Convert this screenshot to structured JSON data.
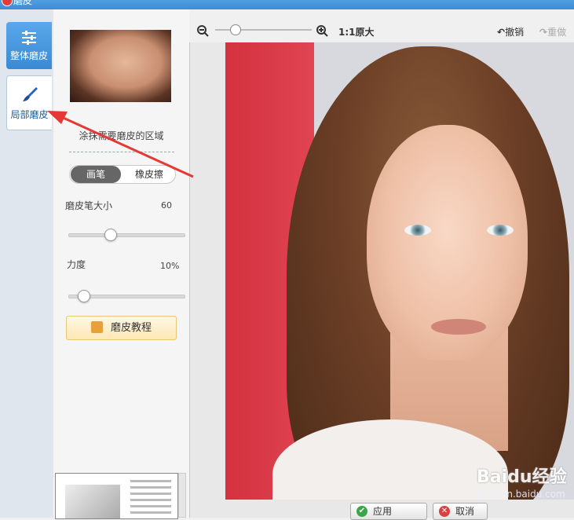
{
  "window": {
    "title": "磨皮"
  },
  "tabs": [
    {
      "label": "整体磨皮",
      "icon": "sliders-icon",
      "state": "active"
    },
    {
      "label": "局部磨皮",
      "icon": "brush-icon",
      "state": "inactive"
    }
  ],
  "panel": {
    "hint": "涂抹需要磨皮的区域",
    "mode_options": [
      "画笔",
      "橡皮擦"
    ],
    "brush_size": {
      "label": "磨皮笔大小",
      "value": "60",
      "level": 0.33
    },
    "strength": {
      "label": "力度",
      "value": "10%",
      "level": 0.1
    },
    "tutorial_label": "磨皮教程"
  },
  "toolbar": {
    "zoom_out_icon": "zoom-out-icon",
    "zoom_in_icon": "zoom-in-icon",
    "actual_size_label": "1:1原大",
    "undo_label": "撤销",
    "redo_label": "重做"
  },
  "watermark": {
    "brand": "Baidu经验",
    "url": "jingyan.baidu.com"
  },
  "buttons": {
    "apply": "应用",
    "cancel": "取消"
  },
  "colors": {
    "accent": "#3a8ad4",
    "annotation": "#e53935"
  }
}
